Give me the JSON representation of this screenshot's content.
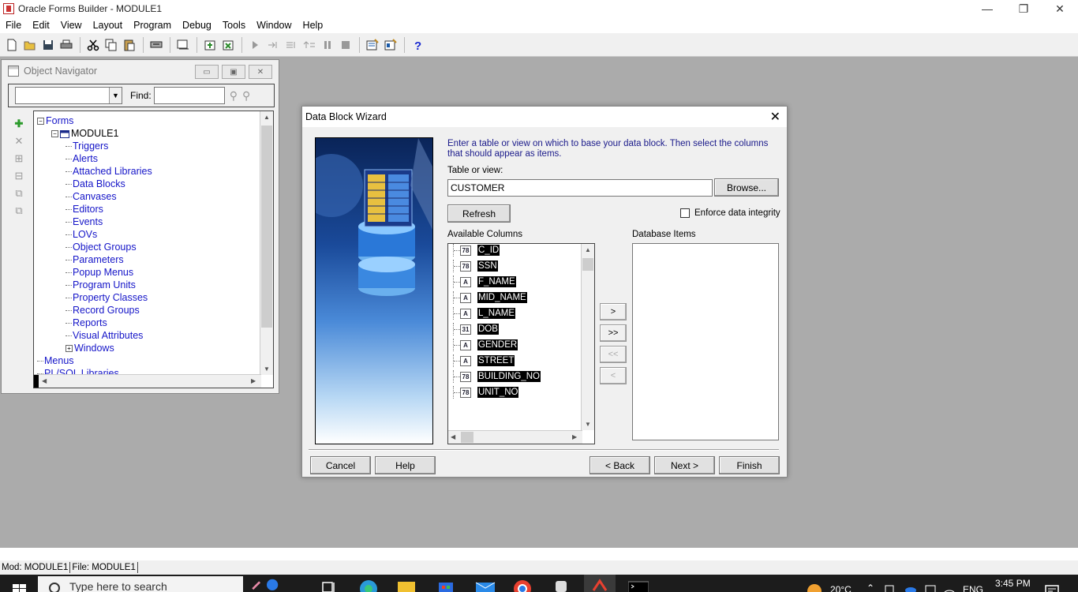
{
  "window": {
    "title": "Oracle Forms Builder - MODULE1",
    "minimize_glyph": "—",
    "restore_glyph": "❐",
    "close_glyph": "✕"
  },
  "menu": [
    "File",
    "Edit",
    "View",
    "Layout",
    "Program",
    "Debug",
    "Tools",
    "Window",
    "Help"
  ],
  "toolbar": {
    "icons": [
      "new-icon",
      "open-icon",
      "save-icon",
      "print-icon",
      "cut-icon",
      "copy-icon",
      "paste-icon",
      "compile-icon",
      "run-form-icon",
      "create-icon",
      "delete-icon",
      "go-icon",
      "step-into-icon",
      "step-over-icon",
      "step-out-icon",
      "pause-icon",
      "stop-icon",
      "data-block-wizard-icon",
      "layout-wizard-icon",
      "help-icon"
    ]
  },
  "object_navigator": {
    "title": "Object Navigator",
    "find_label": "Find:",
    "tree": [
      {
        "label": "Forms",
        "level": 0,
        "expander": "minus"
      },
      {
        "label": "MODULE1",
        "level": 1,
        "expander": "minus"
      },
      {
        "label": "Triggers",
        "level": 2
      },
      {
        "label": "Alerts",
        "level": 2
      },
      {
        "label": "Attached Libraries",
        "level": 2
      },
      {
        "label": "Data Blocks",
        "level": 2
      },
      {
        "label": "Canvases",
        "level": 2
      },
      {
        "label": "Editors",
        "level": 2
      },
      {
        "label": "Events",
        "level": 2
      },
      {
        "label": "LOVs",
        "level": 2
      },
      {
        "label": "Object Groups",
        "level": 2
      },
      {
        "label": "Parameters",
        "level": 2
      },
      {
        "label": "Popup Menus",
        "level": 2
      },
      {
        "label": "Program Units",
        "level": 2
      },
      {
        "label": "Property Classes",
        "level": 2
      },
      {
        "label": "Record Groups",
        "level": 2
      },
      {
        "label": "Reports",
        "level": 2
      },
      {
        "label": "Visual Attributes",
        "level": 2
      },
      {
        "label": "Windows",
        "level": 2,
        "expander": "plus"
      },
      {
        "label": "Menus",
        "level": 0
      },
      {
        "label": "PL/SQL Libraries",
        "level": 0
      }
    ]
  },
  "wizard": {
    "title": "Data Block Wizard",
    "close_glyph": "✕",
    "instruction": "Enter a table or view on which to base your data block. Then select the columns that should appear as items.",
    "table_label": "Table or view:",
    "table_value": "CUSTOMER",
    "browse_label": "Browse...",
    "refresh_label": "Refresh",
    "enforce_label": "Enforce data integrity",
    "enforce_checked": false,
    "available_label": "Available Columns",
    "database_items_label": "Database Items",
    "columns": [
      {
        "name": "C_ID",
        "type": "number"
      },
      {
        "name": "SSN",
        "type": "number"
      },
      {
        "name": "F_NAME",
        "type": "char"
      },
      {
        "name": "MID_NAME",
        "type": "char"
      },
      {
        "name": "L_NAME",
        "type": "char"
      },
      {
        "name": "DOB",
        "type": "date"
      },
      {
        "name": "GENDER",
        "type": "char"
      },
      {
        "name": "STREET",
        "type": "char"
      },
      {
        "name": "BUILDING_NO",
        "type": "number"
      },
      {
        "name": "UNIT_NO",
        "type": "number"
      }
    ],
    "move_buttons": [
      ">",
      ">>",
      "<<",
      "<"
    ],
    "buttons": {
      "cancel": "Cancel",
      "help": "Help",
      "back": "< Back",
      "next": "Next >",
      "finish": "Finish"
    }
  },
  "statusbar": {
    "mod": "Mod: MODULE1",
    "file": "File: MODULE1"
  },
  "taskbar": {
    "search_placeholder": "Type here to search",
    "temperature": "20°C",
    "language": "ENG",
    "time": "3:45 PM"
  }
}
